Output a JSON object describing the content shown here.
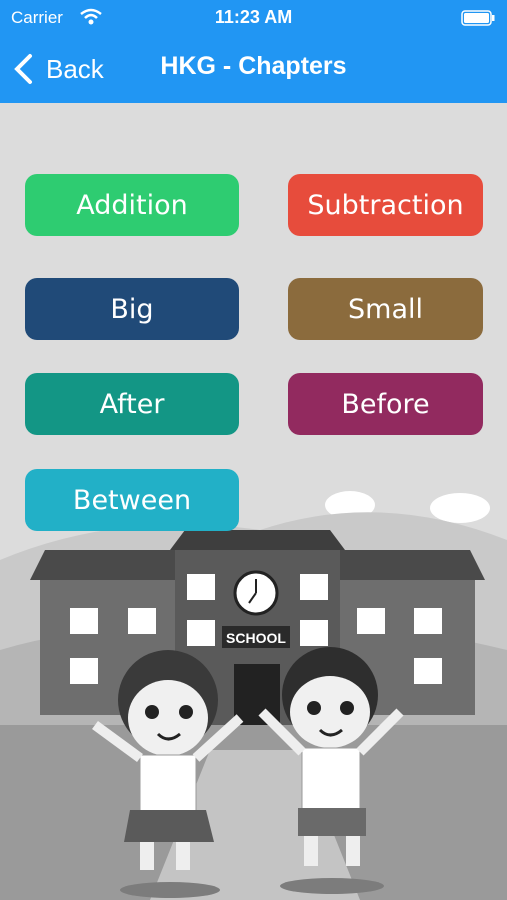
{
  "status_bar": {
    "carrier": "Carrier",
    "time": "11:23 AM"
  },
  "nav": {
    "back_label": "Back",
    "title": "HKG - Chapters"
  },
  "chapters": [
    {
      "label": "Addition",
      "color": "#2ecc71"
    },
    {
      "label": "Subtraction",
      "color": "#e74c3c"
    },
    {
      "label": "Big",
      "color": "#204a78"
    },
    {
      "label": "Small",
      "color": "#8b6b3d"
    },
    {
      "label": "After",
      "color": "#139685"
    },
    {
      "label": "Before",
      "color": "#922a5f"
    },
    {
      "label": "Between",
      "color": "#22b0c7"
    }
  ],
  "illustration": {
    "sign_text": "SCHOOL"
  },
  "colors": {
    "nav_bar": "#2196f3",
    "background": "#dcdcdc"
  }
}
